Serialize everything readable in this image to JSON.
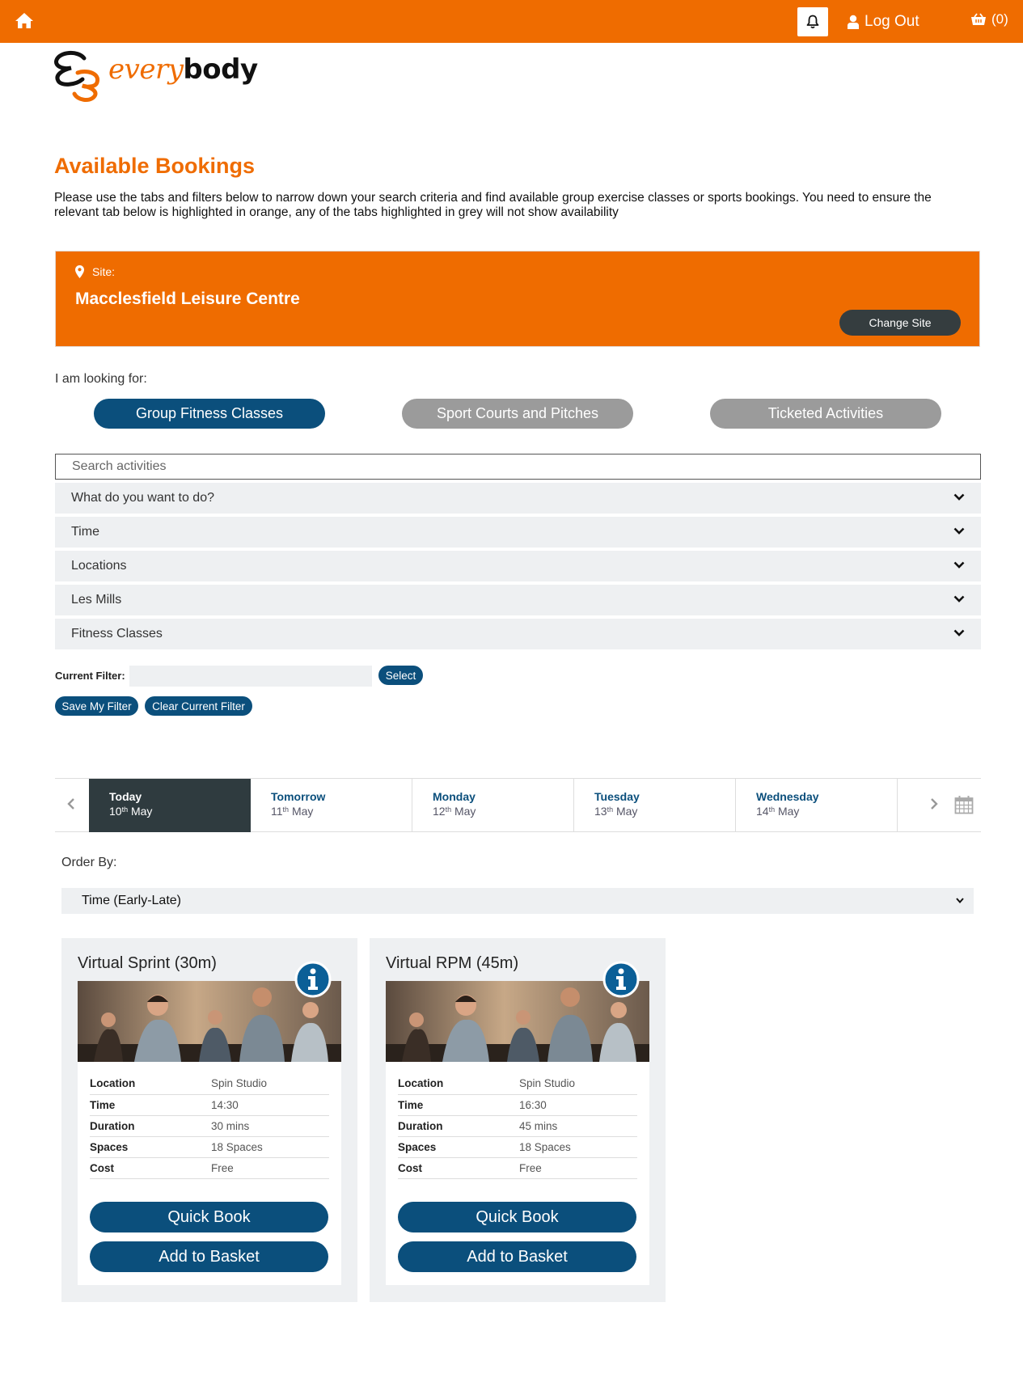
{
  "colors": {
    "brand_orange": "#ef6c00",
    "brand_blue": "#0b4f7c",
    "inactive_grey": "#9b9b9b",
    "dark": "#2f3b3f"
  },
  "topbar": {
    "logout_label": "Log Out",
    "basket_count": "(0)"
  },
  "logo": {
    "every": "every",
    "body": "body"
  },
  "page": {
    "title": "Available Bookings",
    "intro": "Please use the tabs and filters below to narrow down your search criteria and find available group exercise classes or sports bookings. You need to ensure the relevant tab below is highlighted in orange, any of the tabs highlighted in grey will not show availability"
  },
  "site": {
    "label": "Site:",
    "name": "Macclesfield Leisure Centre",
    "change_label": "Change Site"
  },
  "looking_for": {
    "label": "I am looking for:",
    "tabs": [
      {
        "label": "Group Fitness Classes",
        "active": true
      },
      {
        "label": "Sport Courts and Pitches",
        "active": false
      },
      {
        "label": "Ticketed Activities",
        "active": false
      }
    ]
  },
  "search": {
    "placeholder": "Search activities"
  },
  "filters": [
    {
      "label": "What do you want to do?"
    },
    {
      "label": "Time"
    },
    {
      "label": "Locations"
    },
    {
      "label": "Les Mills"
    },
    {
      "label": "Fitness Classes"
    }
  ],
  "current_filter": {
    "label": "Current Filter:",
    "value": "",
    "select_label": "Select",
    "save_label": "Save My Filter",
    "clear_label": "Clear Current Filter"
  },
  "dates": [
    {
      "day": "Today",
      "num": "10",
      "suffix": "th",
      "month": "May",
      "active": true
    },
    {
      "day": "Tomorrow",
      "num": "11",
      "suffix": "th",
      "month": "May",
      "active": false
    },
    {
      "day": "Monday",
      "num": "12",
      "suffix": "th",
      "month": "May",
      "active": false
    },
    {
      "day": "Tuesday",
      "num": "13",
      "suffix": "th",
      "month": "May",
      "active": false
    },
    {
      "day": "Wednesday",
      "num": "14",
      "suffix": "th",
      "month": "May",
      "active": false
    }
  ],
  "order": {
    "label": "Order By:",
    "selected": "Time (Early-Late)"
  },
  "cards": [
    {
      "title": "Virtual Sprint (30m)",
      "rows": [
        {
          "key": "Location",
          "value": "Spin Studio"
        },
        {
          "key": "Time",
          "value": "14:30"
        },
        {
          "key": "Duration",
          "value": "30 mins"
        },
        {
          "key": "Spaces",
          "value": "18 Spaces"
        },
        {
          "key": "Cost",
          "value": "Free"
        }
      ],
      "quick_book": "Quick Book",
      "add_basket": "Add to Basket"
    },
    {
      "title": "Virtual RPM (45m)",
      "rows": [
        {
          "key": "Location",
          "value": "Spin Studio"
        },
        {
          "key": "Time",
          "value": "16:30"
        },
        {
          "key": "Duration",
          "value": "45 mins"
        },
        {
          "key": "Spaces",
          "value": "18 Spaces"
        },
        {
          "key": "Cost",
          "value": "Free"
        }
      ],
      "quick_book": "Quick Book",
      "add_basket": "Add to Basket"
    }
  ]
}
